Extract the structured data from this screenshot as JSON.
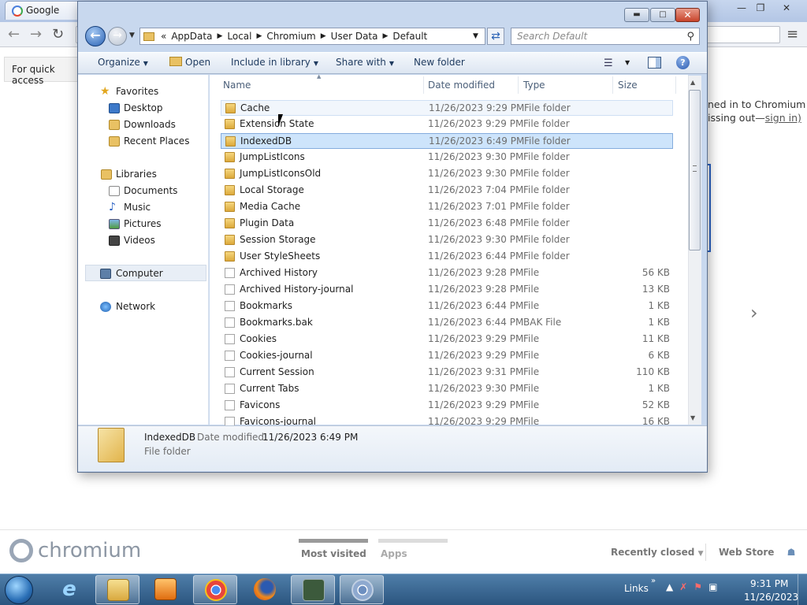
{
  "browser": {
    "tab_title": "Google",
    "infobar_text": "For quick access",
    "signin_line1": "ned in to Chromium",
    "signin_line2": "issing out—",
    "signin_link": "sign in)",
    "brand": "chromium",
    "most_visited": "Most visited",
    "apps": "Apps",
    "recently_closed": "Recently closed",
    "web_store": "Web Store"
  },
  "explorer": {
    "address": {
      "overflow": "«",
      "segments": [
        "AppData",
        "Local",
        "Chromium",
        "User Data",
        "Default"
      ]
    },
    "search_placeholder": "Search Default",
    "toolbar": {
      "organize": "Organize",
      "open": "Open",
      "include_in_library": "Include in library",
      "share_with": "Share with",
      "new_folder": "New folder"
    },
    "nav": {
      "favorites": "Favorites",
      "desktop": "Desktop",
      "downloads": "Downloads",
      "recent_places": "Recent Places",
      "libraries": "Libraries",
      "documents": "Documents",
      "music": "Music",
      "pictures": "Pictures",
      "videos": "Videos",
      "computer": "Computer",
      "network": "Network"
    },
    "columns": {
      "name": "Name",
      "date_modified": "Date modified",
      "type": "Type",
      "size": "Size"
    },
    "files": [
      {
        "name": "Cache",
        "date": "11/26/2023 9:29 PM",
        "type": "File folder",
        "size": "",
        "kind": "folder",
        "state": "hover"
      },
      {
        "name": "Extension State",
        "date": "11/26/2023 9:29 PM",
        "type": "File folder",
        "size": "",
        "kind": "folder",
        "state": ""
      },
      {
        "name": "IndexedDB",
        "date": "11/26/2023 6:49 PM",
        "type": "File folder",
        "size": "",
        "kind": "folder",
        "state": "selected"
      },
      {
        "name": "JumpListIcons",
        "date": "11/26/2023 9:30 PM",
        "type": "File folder",
        "size": "",
        "kind": "folder",
        "state": ""
      },
      {
        "name": "JumpListIconsOld",
        "date": "11/26/2023 9:30 PM",
        "type": "File folder",
        "size": "",
        "kind": "folder",
        "state": ""
      },
      {
        "name": "Local Storage",
        "date": "11/26/2023 7:04 PM",
        "type": "File folder",
        "size": "",
        "kind": "folder",
        "state": ""
      },
      {
        "name": "Media Cache",
        "date": "11/26/2023 7:01 PM",
        "type": "File folder",
        "size": "",
        "kind": "folder",
        "state": ""
      },
      {
        "name": "Plugin Data",
        "date": "11/26/2023 6:48 PM",
        "type": "File folder",
        "size": "",
        "kind": "folder",
        "state": ""
      },
      {
        "name": "Session Storage",
        "date": "11/26/2023 9:30 PM",
        "type": "File folder",
        "size": "",
        "kind": "folder",
        "state": ""
      },
      {
        "name": "User StyleSheets",
        "date": "11/26/2023 6:44 PM",
        "type": "File folder",
        "size": "",
        "kind": "folder",
        "state": ""
      },
      {
        "name": "Archived History",
        "date": "11/26/2023 9:28 PM",
        "type": "File",
        "size": "56 KB",
        "kind": "file",
        "state": ""
      },
      {
        "name": "Archived History-journal",
        "date": "11/26/2023 9:28 PM",
        "type": "File",
        "size": "13 KB",
        "kind": "file",
        "state": ""
      },
      {
        "name": "Bookmarks",
        "date": "11/26/2023 6:44 PM",
        "type": "File",
        "size": "1 KB",
        "kind": "file",
        "state": ""
      },
      {
        "name": "Bookmarks.bak",
        "date": "11/26/2023 6:44 PM",
        "type": "BAK File",
        "size": "1 KB",
        "kind": "file",
        "state": ""
      },
      {
        "name": "Cookies",
        "date": "11/26/2023 9:29 PM",
        "type": "File",
        "size": "11 KB",
        "kind": "file",
        "state": ""
      },
      {
        "name": "Cookies-journal",
        "date": "11/26/2023 9:29 PM",
        "type": "File",
        "size": "6 KB",
        "kind": "file",
        "state": ""
      },
      {
        "name": "Current Session",
        "date": "11/26/2023 9:31 PM",
        "type": "File",
        "size": "110 KB",
        "kind": "file",
        "state": ""
      },
      {
        "name": "Current Tabs",
        "date": "11/26/2023 9:30 PM",
        "type": "File",
        "size": "1 KB",
        "kind": "file",
        "state": ""
      },
      {
        "name": "Favicons",
        "date": "11/26/2023 9:29 PM",
        "type": "File",
        "size": "52 KB",
        "kind": "file",
        "state": ""
      },
      {
        "name": "Favicons-journal",
        "date": "11/26/2023 9:29 PM",
        "type": "File",
        "size": "16 KB",
        "kind": "file",
        "state": ""
      }
    ],
    "details": {
      "name": "IndexedDB",
      "date_label": "Date modified:",
      "date": "11/26/2023 6:49 PM",
      "type": "File folder"
    }
  },
  "taskbar": {
    "links": "Links",
    "time": "9:31 PM",
    "date": "11/26/2023"
  }
}
